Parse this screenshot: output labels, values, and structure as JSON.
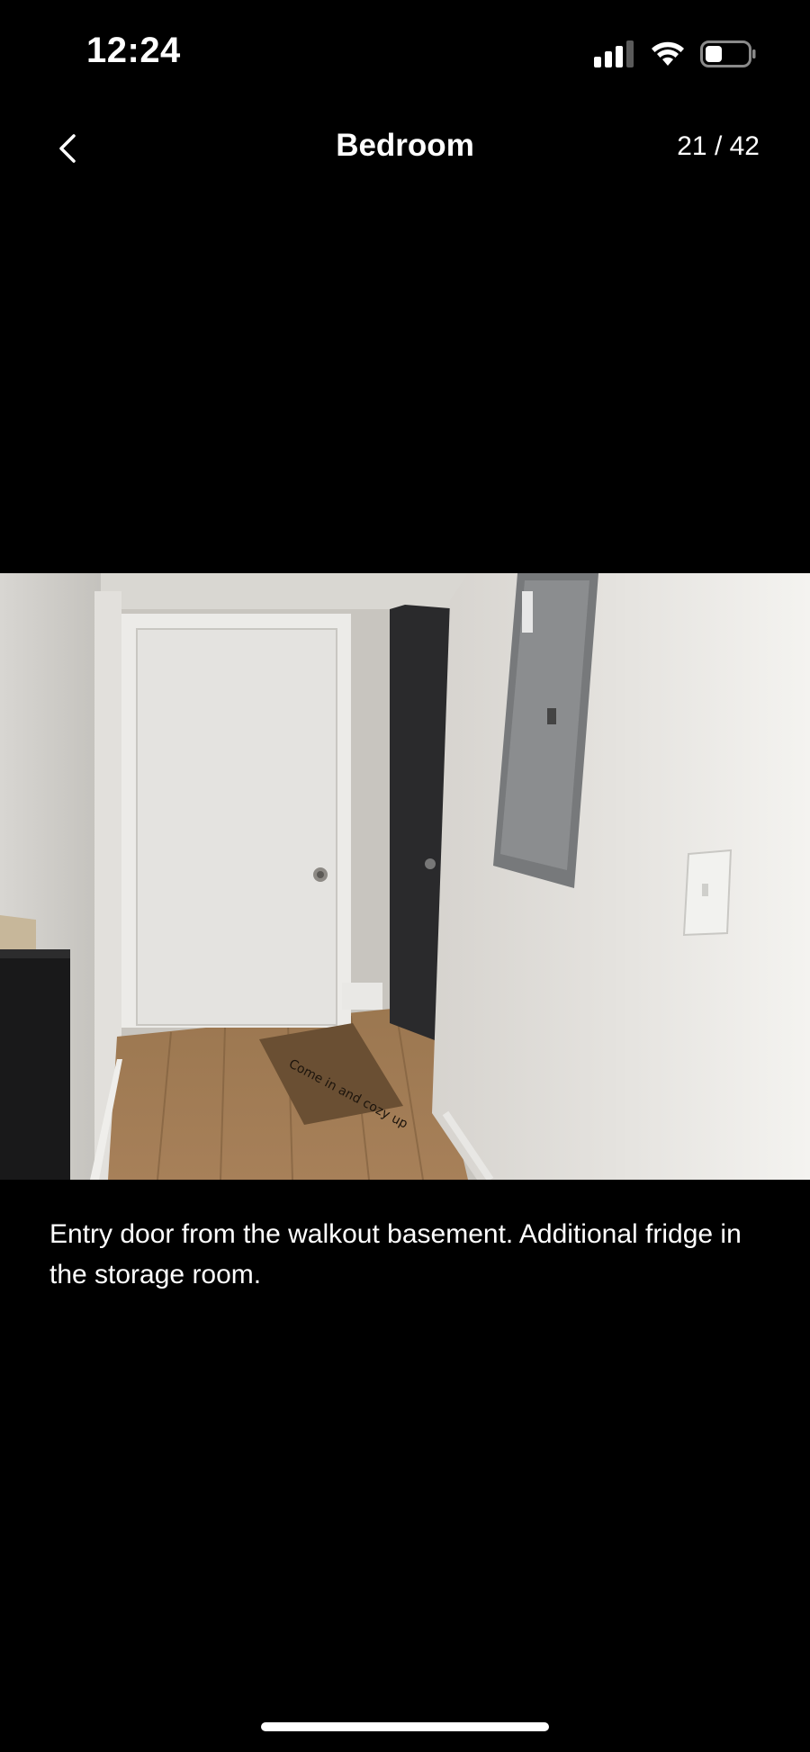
{
  "status_bar": {
    "time": "12:24",
    "icons": [
      "signal-icon",
      "wifi-icon",
      "battery-icon"
    ]
  },
  "header": {
    "back_icon": "chevron-left-icon",
    "title": "Bedroom",
    "counter": "21 / 42"
  },
  "photo": {
    "mat_text": "Come in and cozy up"
  },
  "caption": "Entry door from the walkout basement. Additional fridge in the storage room.",
  "colors": {
    "background": "#000000",
    "text": "#ffffff"
  }
}
